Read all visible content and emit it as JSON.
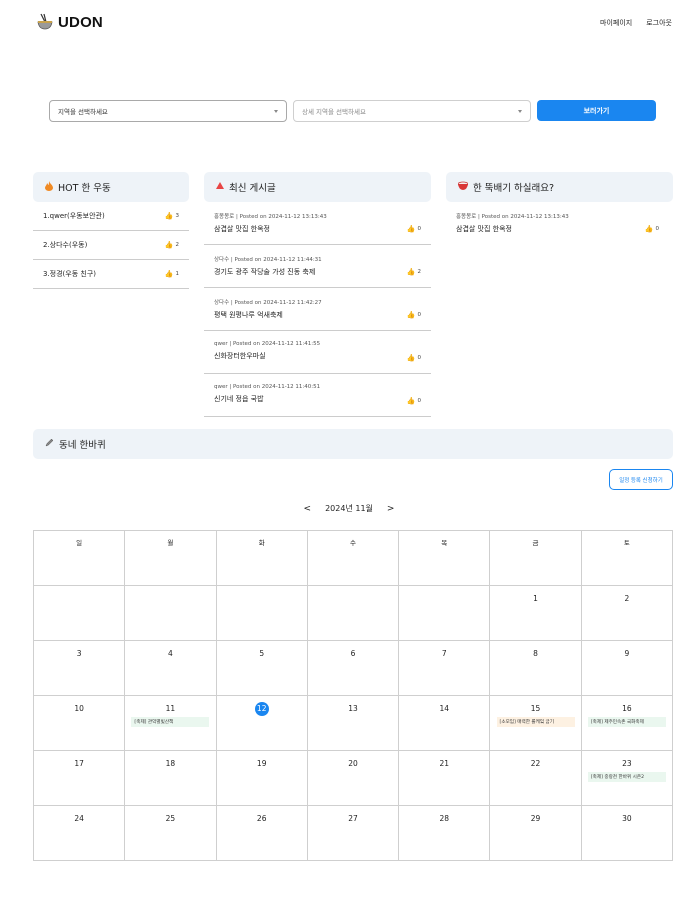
{
  "header": {
    "logo_text": "UDON",
    "nav": [
      "마이페이지",
      "로그아웃"
    ]
  },
  "search": {
    "region_placeholder": "지역을 선택하세요",
    "detail_placeholder": "상세 지역을 선택하세요",
    "view_button": "보러가기"
  },
  "hot": {
    "title": "HOT 한 우동",
    "icon": "fire-icon",
    "items": [
      {
        "label": "1.qwer(우동보안관)",
        "likes": "3"
      },
      {
        "label": "2.상다수(우동)",
        "likes": "2"
      },
      {
        "label": "3.정경(우동 친구)",
        "likes": "1"
      }
    ]
  },
  "recent": {
    "title": "최신 게시글",
    "icon": "triangle-up-icon",
    "items": [
      {
        "meta": "홍몽몽로  |  Posted on 2024-11-12 13:13:43",
        "title": "삼겹살 맛집 한옥정",
        "likes": "0"
      },
      {
        "meta": "상다수  |  Posted on 2024-11-12 11:44:31",
        "title": "경기도 광주 작당술 가성 진동 축제",
        "likes": "2"
      },
      {
        "meta": "상다수  |  Posted on 2024-11-12 11:42:27",
        "title": "평택 원평나루 억새축제",
        "likes": "0"
      },
      {
        "meta": "qwer  |  Posted on 2024-11-12 11:41:55",
        "title": "신화장터한우마실",
        "likes": "0"
      },
      {
        "meta": "qwer  |  Posted on 2024-11-12 11:40:51",
        "title": "신기네 정읍 국밥",
        "likes": "0"
      }
    ]
  },
  "meal": {
    "title": "한 뚝배기 하실래요?",
    "icon": "bowl-icon",
    "items": [
      {
        "meta": "홍몽몽로  |  Posted on 2024-11-12 13:13:43",
        "title": "삼겹살 맛집 한옥정",
        "likes": "0"
      }
    ]
  },
  "neighborhood": {
    "title": "동네 한바퀴",
    "icon": "pencil-icon"
  },
  "calendar": {
    "apply_button": "일정 등록 신청하기",
    "prev": "<",
    "next": ">",
    "month_label": "2024년 11월",
    "weekdays": [
      "일",
      "월",
      "화",
      "수",
      "목",
      "금",
      "토"
    ],
    "today": "12",
    "weeks": [
      [
        "",
        "",
        "",
        "",
        "",
        "1",
        "2"
      ],
      [
        "3",
        "4",
        "5",
        "6",
        "7",
        "8",
        "9"
      ],
      [
        "10",
        "11",
        "12",
        "13",
        "14",
        "15",
        "16"
      ],
      [
        "17",
        "18",
        "19",
        "20",
        "21",
        "22",
        "23"
      ],
      [
        "24",
        "25",
        "26",
        "27",
        "28",
        "29",
        "30"
      ]
    ],
    "events": {
      "11": [
        {
          "text": "[축제] 관악별빛산책",
          "color": "green"
        }
      ],
      "15": [
        {
          "text": "[소모임] 매력한 롤케잌 굽기",
          "color": "orange"
        }
      ],
      "16": [
        {
          "text": "[축제] 제주민속촌 국화축제",
          "color": "green"
        }
      ],
      "23": [
        {
          "text": "[축제] 중랑천 한바퀴 시즌2",
          "color": "green"
        }
      ]
    }
  },
  "colors": {
    "accent": "#1a86f0",
    "panel_bg": "#eef3f8",
    "event_green": "#eaf7ef",
    "event_orange": "#fdf1e2"
  }
}
